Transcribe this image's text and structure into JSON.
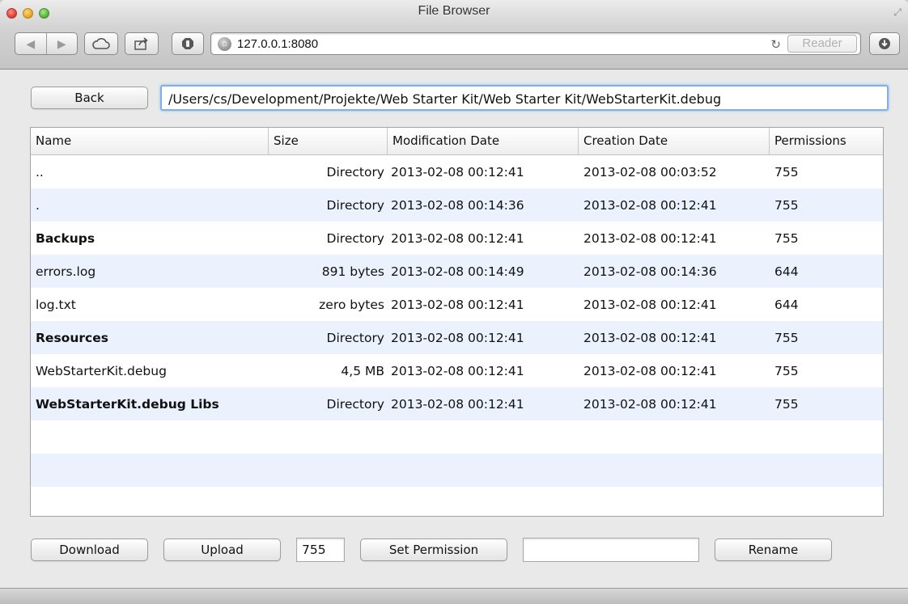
{
  "window": {
    "title": "File Browser"
  },
  "toolbar": {
    "back_glyph": "◀",
    "forward_glyph": "▶",
    "url": "127.0.0.1:8080",
    "reader_label": "Reader",
    "reload_glyph": "↻"
  },
  "icons": {
    "back": "back-arrow-icon",
    "forward": "forward-arrow-icon",
    "cloud": "cloud-icon",
    "share": "share-icon",
    "stop": "stop-icon",
    "globe": "globe-icon",
    "reload": "reload-icon",
    "downloads": "downloads-icon",
    "fullscreen": "fullscreen-icon"
  },
  "nav": {
    "back_label": "Back",
    "path": "/Users/cs/Development/Projekte/Web Starter Kit/Web Starter Kit/WebStarterKit.debug"
  },
  "table": {
    "columns": [
      "Name",
      "Size",
      "Modification Date",
      "Creation Date",
      "Permissions"
    ],
    "rows": [
      {
        "name": "..",
        "size": "Directory",
        "modified": "2013-02-08 00:12:41",
        "created": "2013-02-08 00:03:52",
        "permissions": "755",
        "bold": false
      },
      {
        "name": ".",
        "size": "Directory",
        "modified": "2013-02-08 00:14:36",
        "created": "2013-02-08 00:12:41",
        "permissions": "755",
        "bold": false
      },
      {
        "name": "Backups",
        "size": "Directory",
        "modified": "2013-02-08 00:12:41",
        "created": "2013-02-08 00:12:41",
        "permissions": "755",
        "bold": true
      },
      {
        "name": "errors.log",
        "size": "891 bytes",
        "modified": "2013-02-08 00:14:49",
        "created": "2013-02-08 00:14:36",
        "permissions": "644",
        "bold": false
      },
      {
        "name": "log.txt",
        "size": "zero bytes",
        "modified": "2013-02-08 00:12:41",
        "created": "2013-02-08 00:12:41",
        "permissions": "644",
        "bold": false
      },
      {
        "name": "Resources",
        "size": "Directory",
        "modified": "2013-02-08 00:12:41",
        "created": "2013-02-08 00:12:41",
        "permissions": "755",
        "bold": true
      },
      {
        "name": "WebStarterKit.debug",
        "size": "4,5 MB",
        "modified": "2013-02-08 00:12:41",
        "created": "2013-02-08 00:12:41",
        "permissions": "755",
        "bold": false
      },
      {
        "name": "WebStarterKit.debug Libs",
        "size": "Directory",
        "modified": "2013-02-08 00:12:41",
        "created": "2013-02-08 00:12:41",
        "permissions": "755",
        "bold": true
      }
    ],
    "empty_rows": 3
  },
  "actions": {
    "download_label": "Download",
    "upload_label": "Upload",
    "permission_value": "755",
    "set_permission_label": "Set Permission",
    "rename_value": "",
    "rename_label": "Rename"
  }
}
